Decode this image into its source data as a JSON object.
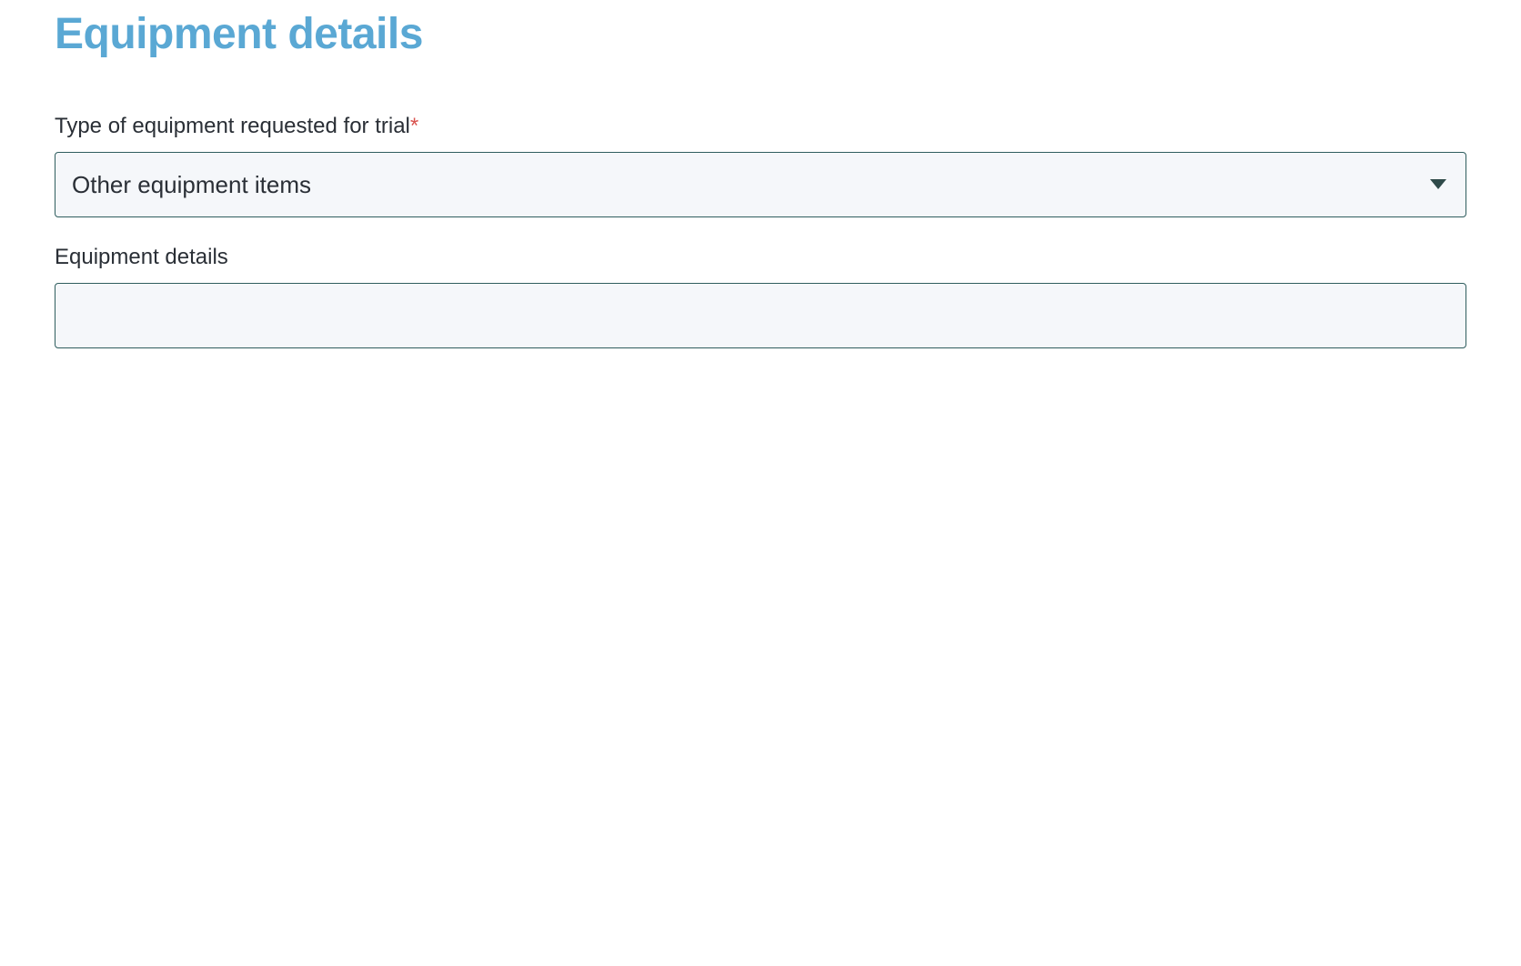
{
  "header": {
    "title": "Equipment details"
  },
  "form": {
    "equipment_type": {
      "label": "Type of equipment requested for trial",
      "required_marker": "*",
      "selected_value": "Other equipment items"
    },
    "equipment_details": {
      "label": "Equipment details",
      "value": ""
    }
  }
}
